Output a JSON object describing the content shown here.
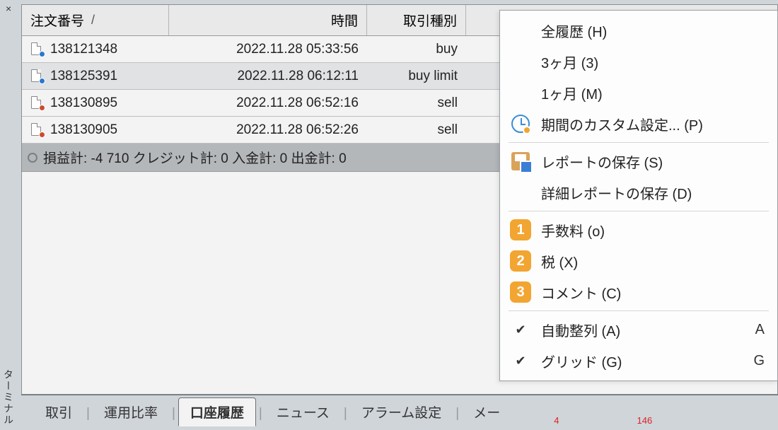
{
  "window": {
    "close_x": "×",
    "vertical_label": "ターミナル"
  },
  "columns": {
    "order": "注文番号",
    "sort_marker": "/",
    "time": "時間",
    "type": "取引種別"
  },
  "rows": [
    {
      "id": "138121348",
      "time": "2022.11.28 05:33:56",
      "type": "buy",
      "dot": "blue",
      "pending": false
    },
    {
      "id": "138125391",
      "time": "2022.11.28 06:12:11",
      "type": "buy limit",
      "dot": "blue",
      "pending": true
    },
    {
      "id": "138130895",
      "time": "2022.11.28 06:52:16",
      "type": "sell",
      "dot": "red",
      "pending": false
    },
    {
      "id": "138130905",
      "time": "2022.11.28 06:52:26",
      "type": "sell",
      "dot": "red",
      "pending": false
    }
  ],
  "summary": {
    "text": "損益計: -4 710  クレジット計: 0  入金計: 0  出金計: 0"
  },
  "tabs": {
    "trade": "取引",
    "exposure": "運用比率",
    "history": "口座履歴",
    "news": "ニュース",
    "alert": "アラーム設定",
    "mail": "メー",
    "badge1": "4",
    "badge2": "146"
  },
  "menu": {
    "all": "全履歴 (H)",
    "m3": "3ヶ月 (3)",
    "m1": "1ヶ月 (M)",
    "custom": "期間のカスタム設定... (P)",
    "save": "レポートの保存 (S)",
    "detail": "詳細レポートの保存 (D)",
    "fee": "手数料 (o)",
    "tax": "税 (X)",
    "comment": "コメント (C)",
    "auto": "自動整列 (A)",
    "grid": "グリッド (G)",
    "accel_auto": "A",
    "accel_grid": "G",
    "num1": "1",
    "num2": "2",
    "num3": "3",
    "check": "✔"
  }
}
